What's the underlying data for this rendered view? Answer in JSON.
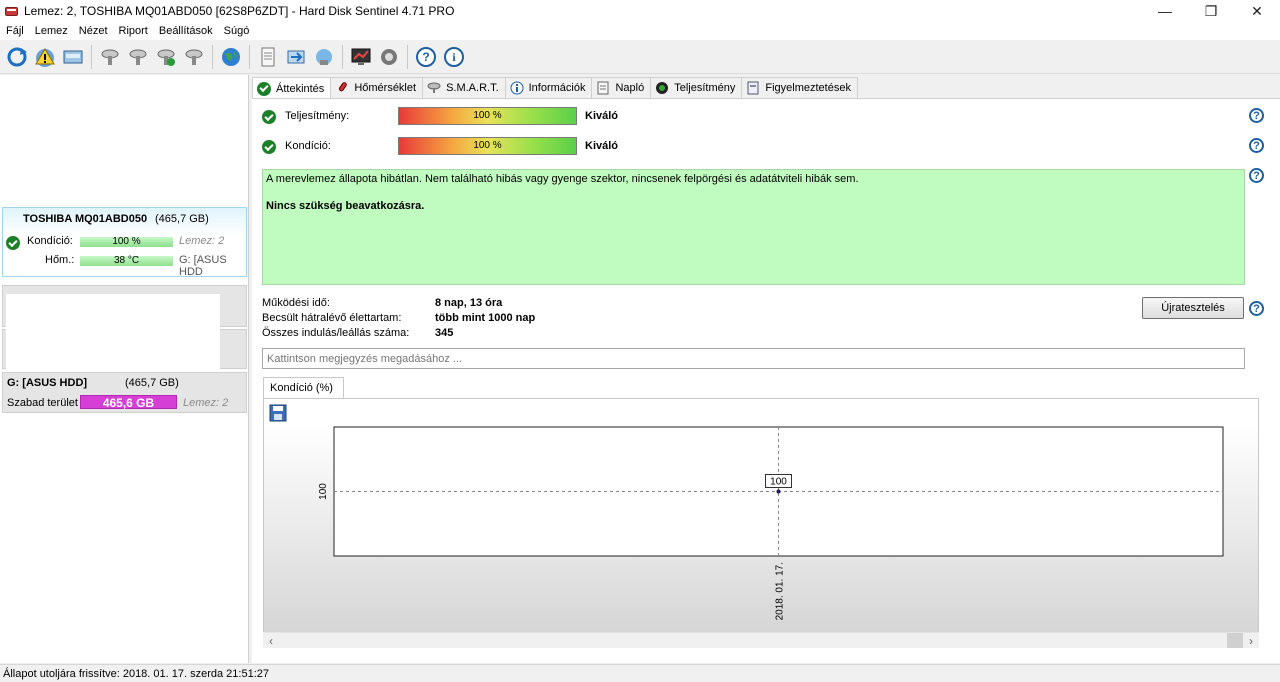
{
  "window": {
    "title": "Lemez: 2, TOSHIBA MQ01ABD050 [62S8P6ZDT]  -  Hard Disk Sentinel 4.71 PRO",
    "minimize": "—",
    "maximize": "❐",
    "close": "✕"
  },
  "menu": {
    "items": [
      {
        "label": "Fájl"
      },
      {
        "label": "Lemez"
      },
      {
        "label": "Nézet"
      },
      {
        "label": "Riport"
      },
      {
        "label": "Beállítások"
      },
      {
        "label": "Súgó"
      }
    ]
  },
  "toolbar": {
    "icons": [
      "refresh-icon",
      "warning-icon",
      "report-icon",
      "disk-settings-icon",
      "disk-test-icon",
      "disk-check-icon",
      "disk-tools-icon",
      "web-icon",
      "document-icon",
      "transfer-icon",
      "network-icon",
      "monitor-icon",
      "settings-icon",
      "help-icon",
      "info-icon"
    ]
  },
  "sidebar": {
    "disk": {
      "name": "TOSHIBA MQ01ABD050",
      "size": "(465,7 GB)",
      "condition_label": "Kondíció:",
      "condition_value": "100 %",
      "disk_ref": "Lemez: 2",
      "temp_label": "Hőm.:",
      "temp_value": "38 °C",
      "partition_ref": "G: [ASUS HDD"
    },
    "partition": {
      "name": "G: [ASUS HDD]",
      "size": "(465,7 GB)",
      "free_label": "Szabad terület",
      "free_value": "465,6 GB",
      "disk_ref": "Lemez: 2"
    }
  },
  "tabs": [
    {
      "label": "Áttekintés",
      "icon": "check-icon"
    },
    {
      "label": "Hőmérséklet",
      "icon": "thermometer-icon"
    },
    {
      "label": "S.M.A.R.T.",
      "icon": "disk-icon"
    },
    {
      "label": "Információk",
      "icon": "info-icon"
    },
    {
      "label": "Napló",
      "icon": "log-icon"
    },
    {
      "label": "Teljesítmény",
      "icon": "speed-icon"
    },
    {
      "label": "Figyelmeztetések",
      "icon": "alert-icon"
    }
  ],
  "overview": {
    "performance_label": "Teljesítmény:",
    "performance_value": "100 %",
    "performance_grade": "Kiváló",
    "condition_label": "Kondíció:",
    "condition_value": "100 %",
    "condition_grade": "Kiváló",
    "status_text": "A merevlemez állapota hibátlan. Nem található hibás vagy gyenge szektor, nincsenek felpörgési és adatátviteli hibák sem.",
    "recommendation": "Nincs szükség beavatkozásra.",
    "uptime_label": "Működési idő:",
    "uptime_value": "8 nap, 13 óra",
    "lifetime_label": "Becsült hátralévő élettartam:",
    "lifetime_value": "több mint 1000 nap",
    "starts_label": "Összes indulás/leállás száma:",
    "starts_value": "345",
    "reset_button": "Újratesztelés",
    "note_placeholder": "Kattintson megjegyzés megadásához ..."
  },
  "chart_tab": "Kondíció  (%)",
  "chart_data": {
    "type": "line",
    "x": [
      "2018. 01. 17."
    ],
    "series": [
      {
        "values": [
          100
        ]
      }
    ],
    "ylabel": "",
    "y_ticks": [
      "100"
    ],
    "data_labels": [
      "100"
    ]
  },
  "statusbar": {
    "text": "Állapot utoljára frissítve: 2018. 01. 17. szerda 21:51:27"
  }
}
